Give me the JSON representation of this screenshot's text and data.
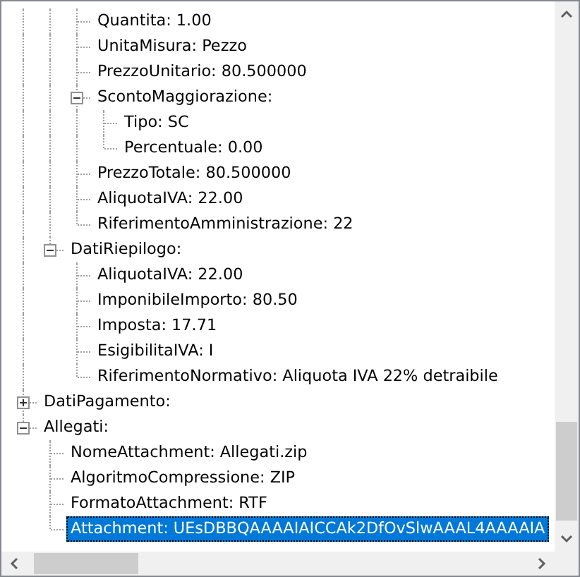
{
  "tree": [
    {
      "children": [
        {
          "children": [
            {
              "label": "Quantita: 1.00",
              "selected": false
            },
            {
              "label": "UnitaMisura: Pezzo",
              "selected": false
            },
            {
              "label": "PrezzoUnitario: 80.500000",
              "selected": false
            },
            {
              "label": "ScontoMaggiorazione:",
              "selected": false,
              "expanded": true,
              "children": [
                {
                  "label": "Tipo: SC",
                  "selected": false
                },
                {
                  "label": "Percentuale: 0.00",
                  "selected": false
                }
              ]
            },
            {
              "label": "PrezzoTotale: 80.500000",
              "selected": false
            },
            {
              "label": "AliquotaIVA: 22.00",
              "selected": false
            },
            {
              "label": "RiferimentoAmministrazione: 22",
              "selected": false
            }
          ]
        },
        {
          "label": "DatiRiepilogo:",
          "selected": false,
          "expanded": true,
          "children": [
            {
              "label": "AliquotaIVA: 22.00",
              "selected": false
            },
            {
              "label": "ImponibileImporto: 80.50",
              "selected": false
            },
            {
              "label": "Imposta: 17.71",
              "selected": false
            },
            {
              "label": "EsigibilitaIVA: I",
              "selected": false
            },
            {
              "label": "RiferimentoNormativo: Aliquota IVA 22% detraibile",
              "selected": false
            }
          ]
        }
      ]
    },
    {
      "label": "DatiPagamento:",
      "selected": false,
      "expanded": false
    },
    {
      "label": "Allegati:",
      "selected": false,
      "expanded": true,
      "children": [
        {
          "label": "NomeAttachment: Allegati.zip",
          "selected": false
        },
        {
          "label": "AlgoritmoCompressione: ZIP",
          "selected": false
        },
        {
          "label": "FormatoAttachment: RTF",
          "selected": false
        },
        {
          "label": "Attachment: UEsDBBQAAAAIAICCAk2DfOvSlwAAAL4AAAAIA",
          "selected": true
        }
      ]
    }
  ]
}
